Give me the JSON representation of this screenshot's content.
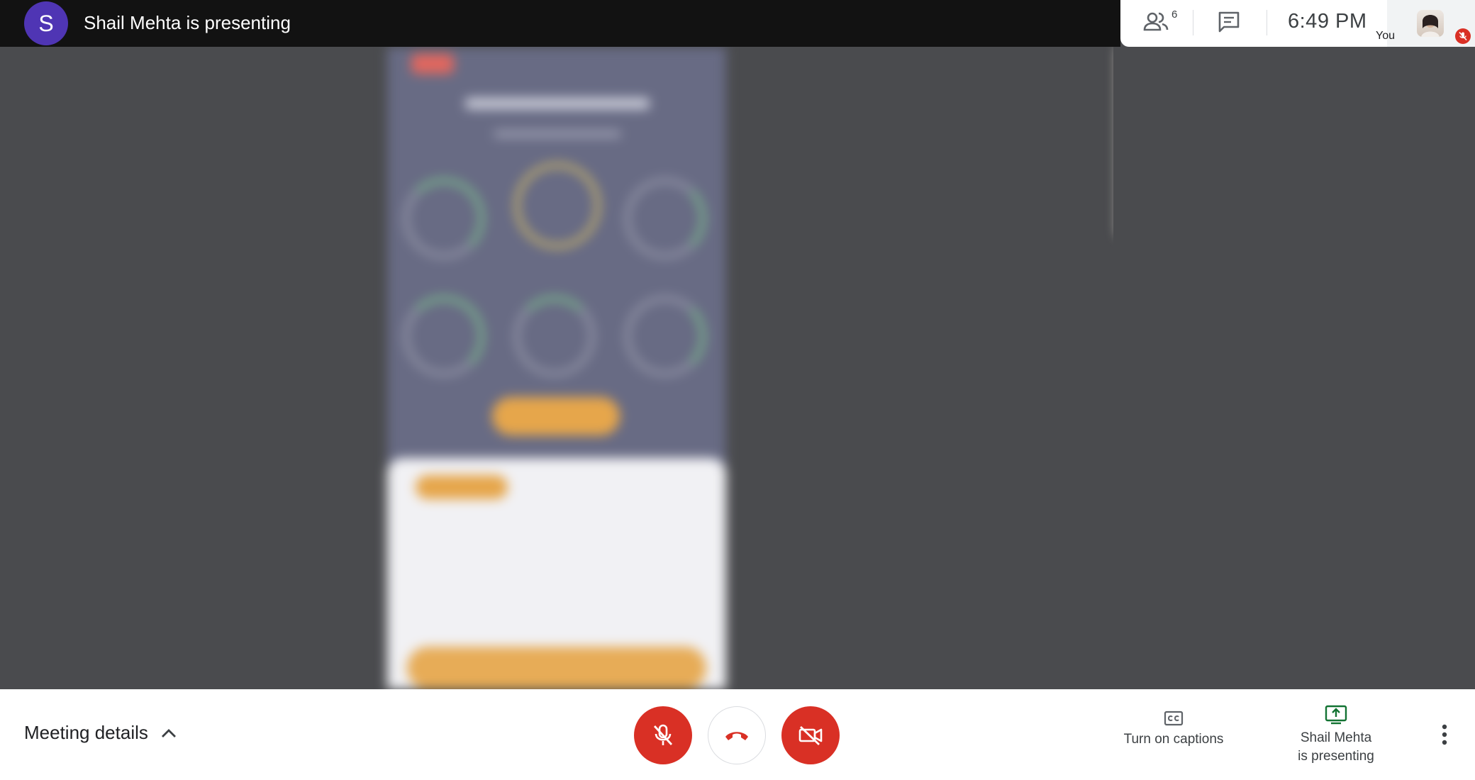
{
  "header": {
    "presenter_initial": "S",
    "presenting_title": "Shail Mehta is presenting",
    "participant_count": "6",
    "time": "6:49 PM",
    "self_label": "You"
  },
  "icons": {
    "people": "people-icon",
    "chat": "chat-icon",
    "mic_off": "mic-off-icon",
    "hang_up": "phone-hangup-icon",
    "camera_off": "camera-off-icon",
    "captions": "closed-captions-icon",
    "present": "present-screen-icon",
    "more": "more-vert-icon",
    "expand": "chevron-up-icon"
  },
  "colors": {
    "presenter_avatar": "#4f35b4",
    "danger": "#d93025",
    "present_accent": "#137333"
  },
  "footer": {
    "meeting_details": "Meeting details",
    "captions_label": "Turn on captions",
    "presenting_line1": "Shail Mehta",
    "presenting_line2": "is presenting"
  }
}
